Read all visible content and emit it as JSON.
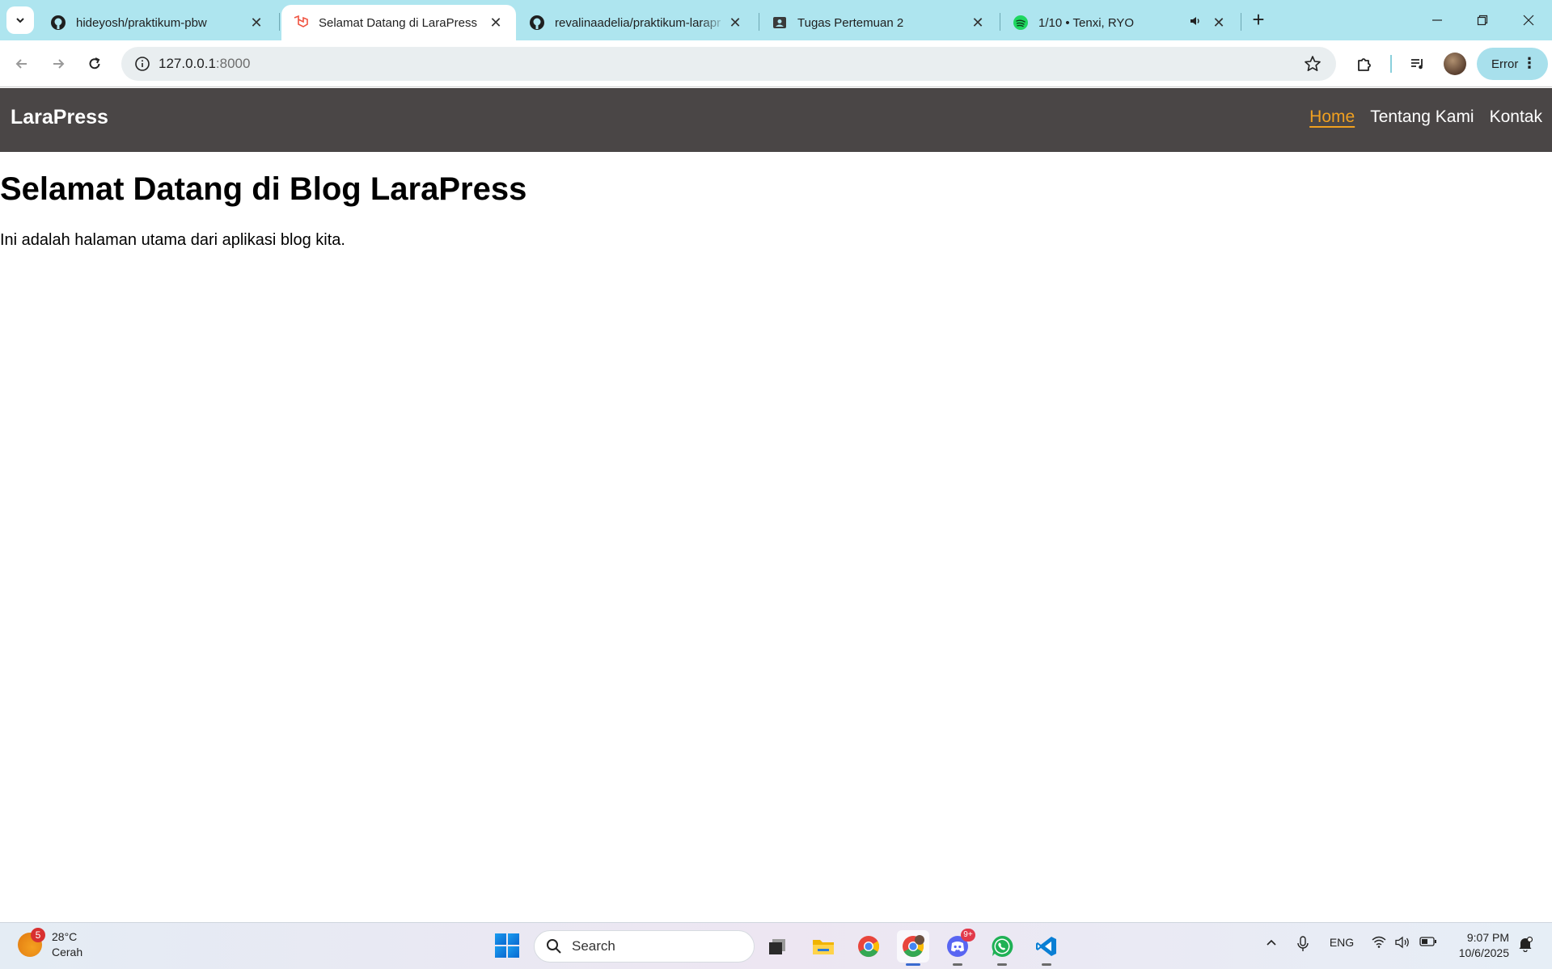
{
  "browser": {
    "tabs": [
      {
        "title": "hideyosh/praktikum-pbw",
        "icon": "github-icon"
      },
      {
        "title": "Selamat Datang di LaraPress",
        "icon": "laravel-icon",
        "active": true
      },
      {
        "title": "revalinaadelia/praktikum-larapr",
        "icon": "github-icon"
      },
      {
        "title": "Tugas Pertemuan 2",
        "icon": "classroom-icon"
      },
      {
        "title": "1/10 • Tenxi, RYO",
        "icon": "spotify-icon",
        "audio": true
      }
    ],
    "address": {
      "host": "127.0.0.1",
      "port": ":8000"
    },
    "profile_button": "Error"
  },
  "site": {
    "brand": "LaraPress",
    "nav": [
      {
        "label": "Home",
        "active": true
      },
      {
        "label": "Tentang Kami"
      },
      {
        "label": "Kontak"
      }
    ],
    "heading": "Selamat Datang di Blog LaraPress",
    "intro": "Ini adalah halaman utama dari aplikasi blog kita.",
    "colors": {
      "navbar": "#4a4646",
      "active_link": "#f0a020"
    }
  },
  "taskbar": {
    "weather": {
      "badge": "5",
      "temp": "28°C",
      "condition": "Cerah"
    },
    "search_placeholder": "Search",
    "apps": [
      "task-view",
      "file-explorer",
      "chrome",
      "chrome-profile",
      "discord",
      "whatsapp",
      "vscode"
    ],
    "discord_badge": "9+",
    "language": "ENG",
    "time": "9:07 PM",
    "date": "10/6/2025"
  }
}
